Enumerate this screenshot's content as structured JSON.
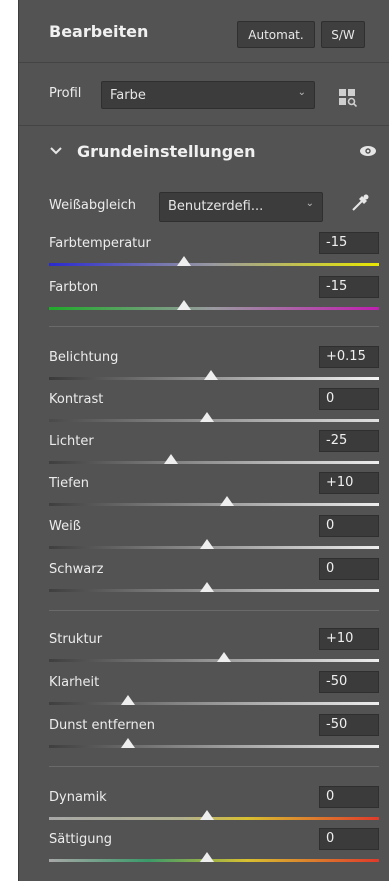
{
  "header": {
    "title": "Bearbeiten",
    "auto_label": "Automat.",
    "bw_label": "S/W"
  },
  "profile": {
    "label": "Profil",
    "value": "Farbe"
  },
  "section": {
    "title": "Grundeinstellungen"
  },
  "white_balance": {
    "label": "Weißabgleich",
    "value": "Benutzerdefi..."
  },
  "sliders": {
    "farbtemperatur": {
      "label": "Farbtemperatur",
      "value": "-15",
      "fraction": 0.41
    },
    "farbton": {
      "label": "Farbton",
      "value": "-15",
      "fraction": 0.41
    },
    "belichtung": {
      "label": "Belichtung",
      "value": "+0.15",
      "fraction": 0.49
    },
    "kontrast": {
      "label": "Kontrast",
      "value": "0",
      "fraction": 0.48
    },
    "lichter": {
      "label": "Lichter",
      "value": "-25",
      "fraction": 0.37
    },
    "tiefen": {
      "label": "Tiefen",
      "value": "+10",
      "fraction": 0.54
    },
    "weiss": {
      "label": "Weiß",
      "value": "0",
      "fraction": 0.48
    },
    "schwarz": {
      "label": "Schwarz",
      "value": "0",
      "fraction": 0.48
    },
    "struktur": {
      "label": "Struktur",
      "value": "+10",
      "fraction": 0.53
    },
    "klarheit": {
      "label": "Klarheit",
      "value": "-50",
      "fraction": 0.24
    },
    "dunst": {
      "label": "Dunst entfernen",
      "value": "-50",
      "fraction": 0.24
    },
    "dynamik": {
      "label": "Dynamik",
      "value": "0",
      "fraction": 0.48
    },
    "saettigung": {
      "label": "Sättigung",
      "value": "0",
      "fraction": 0.48
    }
  },
  "colors": {
    "panel_bg": "#535353",
    "thumb": "#eeeeee"
  }
}
